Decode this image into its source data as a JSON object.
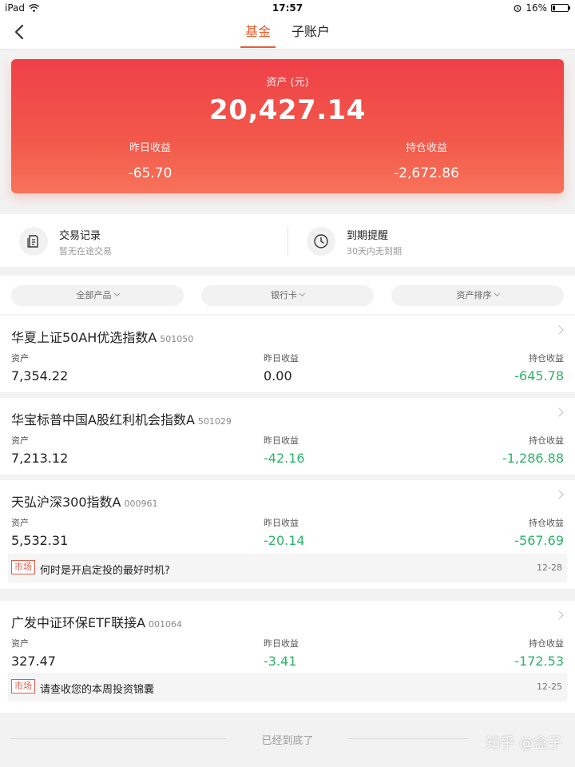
{
  "status_bar": {
    "device": "iPad",
    "time": "17:57",
    "battery": "16%",
    "battery_level": 0.16
  },
  "nav": {
    "tabs": [
      {
        "label": "基金",
        "active": true
      },
      {
        "label": "子账户",
        "active": false
      }
    ]
  },
  "summary": {
    "asset_label": "资产 (元)",
    "asset_value": "20,427.14",
    "yesterday_label": "昨日收益",
    "yesterday_value": "-65.70",
    "holding_label": "持仓收益",
    "holding_value": "-2,672.86"
  },
  "quick_links": [
    {
      "title": "交易记录",
      "subtitle": "暂无在途交易",
      "icon": "document-icon"
    },
    {
      "title": "到期提醒",
      "subtitle": "30天内无到期",
      "icon": "clock-icon"
    }
  ],
  "filters": [
    "全部产品",
    "银行卡",
    "资产排序"
  ],
  "funds": [
    {
      "name": "华夏上证50AH优选指数A",
      "code": "501050",
      "asset_label": "资产",
      "asset": "7,354.22",
      "yesterday_label": "昨日收益",
      "yesterday": "0.00",
      "holding_label": "持仓收益",
      "holding": "-645.78"
    },
    {
      "name": "华宝标普中国A股红利机会指数A",
      "code": "501029",
      "asset_label": "资产",
      "asset": "7,213.12",
      "yesterday_label": "昨日收益",
      "yesterday": "-42.16",
      "holding_label": "持仓收益",
      "holding": "-1,286.88"
    },
    {
      "name": "天弘沪深300指数A",
      "code": "000961",
      "asset_label": "资产",
      "asset": "5,532.31",
      "yesterday_label": "昨日收益",
      "yesterday": "-20.14",
      "holding_label": "持仓收益",
      "holding": "-567.69",
      "news": {
        "tag": "市场",
        "text": "何时是开启定投的最好时机?",
        "date": "12-28"
      }
    },
    {
      "name": "广发中证环保ETF联接A",
      "code": "001064",
      "asset_label": "资产",
      "asset": "327.47",
      "yesterday_label": "昨日收益",
      "yesterday": "-3.41",
      "holding_label": "持仓收益",
      "holding": "-172.53",
      "news": {
        "tag": "市场",
        "text": "请查收您的本周投资锦囊",
        "date": "12-25"
      }
    }
  ],
  "footer": {
    "end_text": "已经到底了",
    "watermark": "知乎 @盒子"
  },
  "colors": {
    "accent": "#e85d2a",
    "hero_top": "#ef4048",
    "hero_bottom": "#f7735a",
    "loss_green": "#2cb36a",
    "tag_red": "#e45a4a"
  }
}
